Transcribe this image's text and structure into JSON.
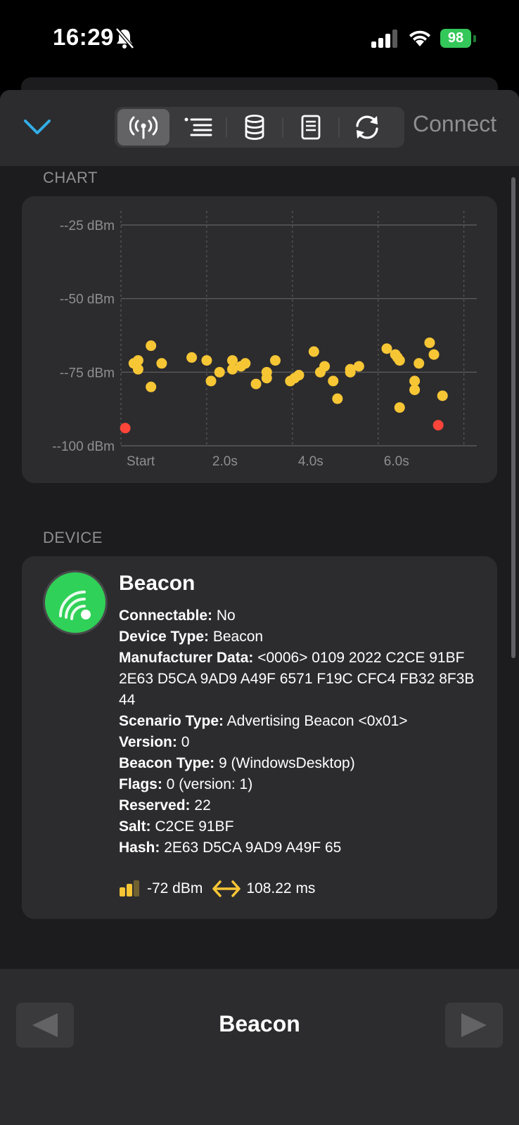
{
  "status_bar": {
    "time": "16:29",
    "battery": "98"
  },
  "toolbar": {
    "connect_label": "Connect",
    "segments": [
      "antenna-icon",
      "list-icon",
      "database-icon",
      "document-icon",
      "refresh-icon"
    ],
    "selected_segment": 0
  },
  "chart_section": {
    "label": "CHART"
  },
  "chart_data": {
    "type": "scatter",
    "y_ticks": [
      "--25 dBm",
      "--50 dBm",
      "--75 dBm",
      "--100 dBm"
    ],
    "x_ticks": [
      "Start",
      "2.0s",
      "4.0s",
      "6.0s"
    ],
    "ylim": [
      -100,
      -25
    ],
    "xlim": [
      0,
      8.3
    ],
    "grid": true,
    "series": [
      {
        "color": "#f7c635",
        "points": [
          [
            0.3,
            -72
          ],
          [
            0.4,
            -71
          ],
          [
            0.4,
            -74
          ],
          [
            0.7,
            -66
          ],
          [
            0.7,
            -80
          ],
          [
            0.95,
            -72
          ],
          [
            1.65,
            -70
          ],
          [
            2.0,
            -71
          ],
          [
            2.1,
            -78
          ],
          [
            2.3,
            -75
          ],
          [
            2.6,
            -74
          ],
          [
            2.6,
            -71
          ],
          [
            2.8,
            -73
          ],
          [
            2.9,
            -72
          ],
          [
            3.15,
            -79
          ],
          [
            3.4,
            -75
          ],
          [
            3.4,
            -77
          ],
          [
            3.6,
            -71
          ],
          [
            3.95,
            -78
          ],
          [
            4.05,
            -77
          ],
          [
            4.15,
            -76
          ],
          [
            4.5,
            -68
          ],
          [
            4.65,
            -75
          ],
          [
            4.75,
            -73
          ],
          [
            4.95,
            -78
          ],
          [
            5.05,
            -84
          ],
          [
            5.35,
            -74
          ],
          [
            5.35,
            -75
          ],
          [
            5.55,
            -73
          ],
          [
            6.2,
            -67
          ],
          [
            6.4,
            -69
          ],
          [
            6.45,
            -70
          ],
          [
            6.5,
            -71
          ],
          [
            6.5,
            -87
          ],
          [
            6.85,
            -78
          ],
          [
            6.85,
            -81
          ],
          [
            6.95,
            -72
          ],
          [
            7.2,
            -65
          ],
          [
            7.3,
            -69
          ],
          [
            7.5,
            -83
          ]
        ]
      },
      {
        "color": "#ff453a",
        "points": [
          [
            0.1,
            -94
          ],
          [
            7.4,
            -93
          ]
        ]
      }
    ]
  },
  "device_section": {
    "label": "DEVICE"
  },
  "device": {
    "name": "Beacon",
    "fields": [
      {
        "key": "Connectable:",
        "value": " No"
      },
      {
        "key": "Device Type:",
        "value": " Beacon"
      },
      {
        "key": "Manufacturer Data:",
        "value": " <0006> 0109 2022 C2CE 91BF 2E63 D5CA 9AD9 A49F 6571 F19C CFC4 FB32 8F3B 44"
      },
      {
        "key": "Scenario Type:",
        "value": " Advertising Beacon <0x01>"
      },
      {
        "key": "Version:",
        "value": " 0"
      },
      {
        "key": "Beacon Type:",
        "value": " 9 (WindowsDesktop)"
      },
      {
        "key": "Flags:",
        "value": " 0 (version: 1)"
      },
      {
        "key": "Reserved:",
        "value": " 22"
      },
      {
        "key": "Salt:",
        "value": " C2CE 91BF"
      },
      {
        "key": "Hash:",
        "value": " 2E63 D5CA 9AD9 A49F 65"
      }
    ],
    "rssi": "-72 dBm",
    "interval": "108.22 ms"
  },
  "bottom": {
    "title": "Beacon"
  },
  "colors": {
    "accent": "#32ade6",
    "point": "#f7c635",
    "point_alert": "#ff453a",
    "device_green": "#30d158"
  }
}
